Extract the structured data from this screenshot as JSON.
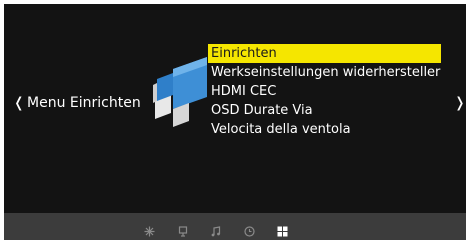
{
  "colors": {
    "background": "#131313",
    "highlight": "#f5e600",
    "bottom_bar": "#3c3c3c",
    "text": "#ffffff"
  },
  "nav": {
    "left_arrow": "❬",
    "right_arrow": "❭"
  },
  "menu": {
    "title": "Menu Einrichten",
    "icon": "settings-tiles-icon",
    "items": [
      {
        "label": "Einrichten",
        "selected": true
      },
      {
        "label": "Werkseinstellungen widerhersteller",
        "selected": false
      },
      {
        "label": "HDMI CEC",
        "selected": false
      },
      {
        "label": "OSD Durate Via",
        "selected": false
      },
      {
        "label": "Velocita della ventola",
        "selected": false
      }
    ]
  },
  "bottom_tabs": [
    {
      "icon": "picture-icon",
      "active": false
    },
    {
      "icon": "display-icon",
      "active": false
    },
    {
      "icon": "music-icon",
      "active": false
    },
    {
      "icon": "clock-icon",
      "active": false
    },
    {
      "icon": "setup-icon",
      "active": true
    }
  ]
}
